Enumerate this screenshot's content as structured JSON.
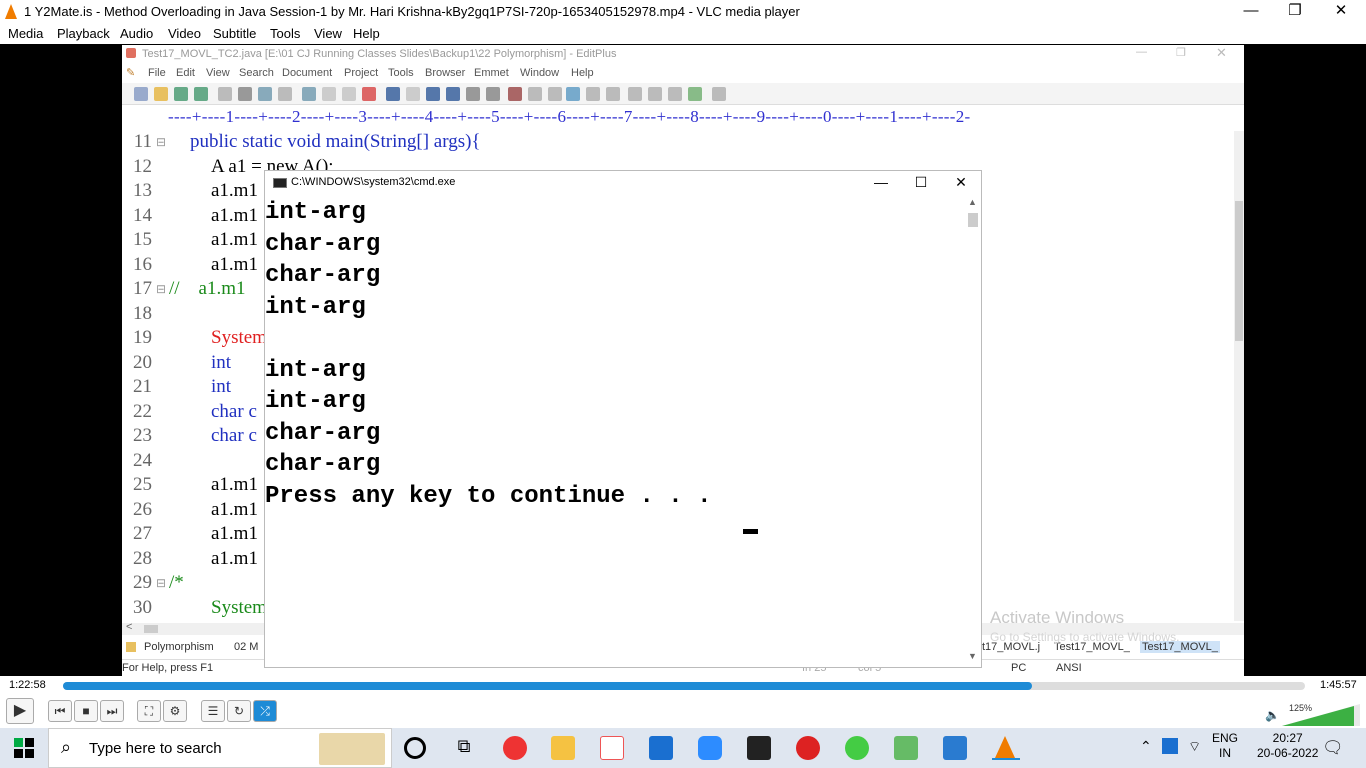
{
  "vlc": {
    "title": "1 Y2Mate.is - Method Overloading in Java  Session-1  by Mr. Hari Krishna-kBy2gq1P7SI-720p-1653405152978.mp4 - VLC media player",
    "menu": [
      "Media",
      "Playback",
      "Audio",
      "Video",
      "Subtitle",
      "Tools",
      "View",
      "Help"
    ],
    "time_current": "1:22:58",
    "time_total": "1:45:57",
    "progress": 0.78,
    "volume": "125%"
  },
  "editplus": {
    "title": "Test17_MOVL_TC2.java [E:\\01 CJ Running Classes Slides\\Backup1\\22 Polymorphism] - EditPlus",
    "menu": [
      "File",
      "Edit",
      "View",
      "Search",
      "Document",
      "Project",
      "Tools",
      "Browser",
      "Emmet",
      "Window",
      "Help"
    ],
    "ruler": "----+----1----+----2----+----3----+----4----+----5----+----6----+----7----+----8----+----9----+----0----+----1----+----2-",
    "lines": [
      {
        "n": "11",
        "fold": "⊟",
        "code": "public static void main(String[] args){"
      },
      {
        "n": "12",
        "fold": "",
        "code": "A a1 = new A();"
      },
      {
        "n": "13",
        "fold": "",
        "code": "a1.m1"
      },
      {
        "n": "14",
        "fold": "",
        "code": "a1.m1"
      },
      {
        "n": "15",
        "fold": "",
        "code": "a1.m1"
      },
      {
        "n": "16",
        "fold": "",
        "code": "a1.m1"
      },
      {
        "n": "17",
        "fold": "⊟",
        "code": "//    a1.m1"
      },
      {
        "n": "18",
        "fold": "",
        "code": ""
      },
      {
        "n": "19",
        "fold": "",
        "code": "System"
      },
      {
        "n": "20",
        "fold": "",
        "code": "int"
      },
      {
        "n": "21",
        "fold": "",
        "code": "int"
      },
      {
        "n": "22",
        "fold": "",
        "code": "char c"
      },
      {
        "n": "23",
        "fold": "",
        "code": "char c"
      },
      {
        "n": "24",
        "fold": "",
        "code": ""
      },
      {
        "n": "25",
        "fold": "",
        "code": "a1.m1"
      },
      {
        "n": "26",
        "fold": "",
        "code": "a1.m1"
      },
      {
        "n": "27",
        "fold": "",
        "code": "a1.m1"
      },
      {
        "n": "28",
        "fold": "",
        "code": "a1.m1"
      },
      {
        "n": "29",
        "fold": "⊟",
        "code": "/*"
      },
      {
        "n": "30",
        "fold": "",
        "code": "System"
      }
    ],
    "tabs": [
      "Polymorphism",
      "02 M",
      "t17_MOVL.j",
      "Test17_MOVL_",
      "Test17_MOVL_"
    ],
    "status_help": "For Help, press F1",
    "status_ln": "In 25",
    "status_col": "col 5",
    "status_pc": "PC",
    "status_ansi": "ANSI"
  },
  "cmd": {
    "title": "C:\\WINDOWS\\system32\\cmd.exe",
    "lines": [
      "int-arg",
      "char-arg",
      "char-arg",
      "int-arg",
      "",
      "int-arg",
      "int-arg",
      "char-arg",
      "char-arg",
      "Press any key to continue . . ."
    ]
  },
  "watermark": {
    "title": "Activate Windows",
    "sub": "Go to Settings to activate Windows."
  },
  "taskbar": {
    "search_placeholder": "Type here to search",
    "lang1": "ENG",
    "lang2": "IN",
    "time": "20:27",
    "date": "20-06-2022"
  }
}
